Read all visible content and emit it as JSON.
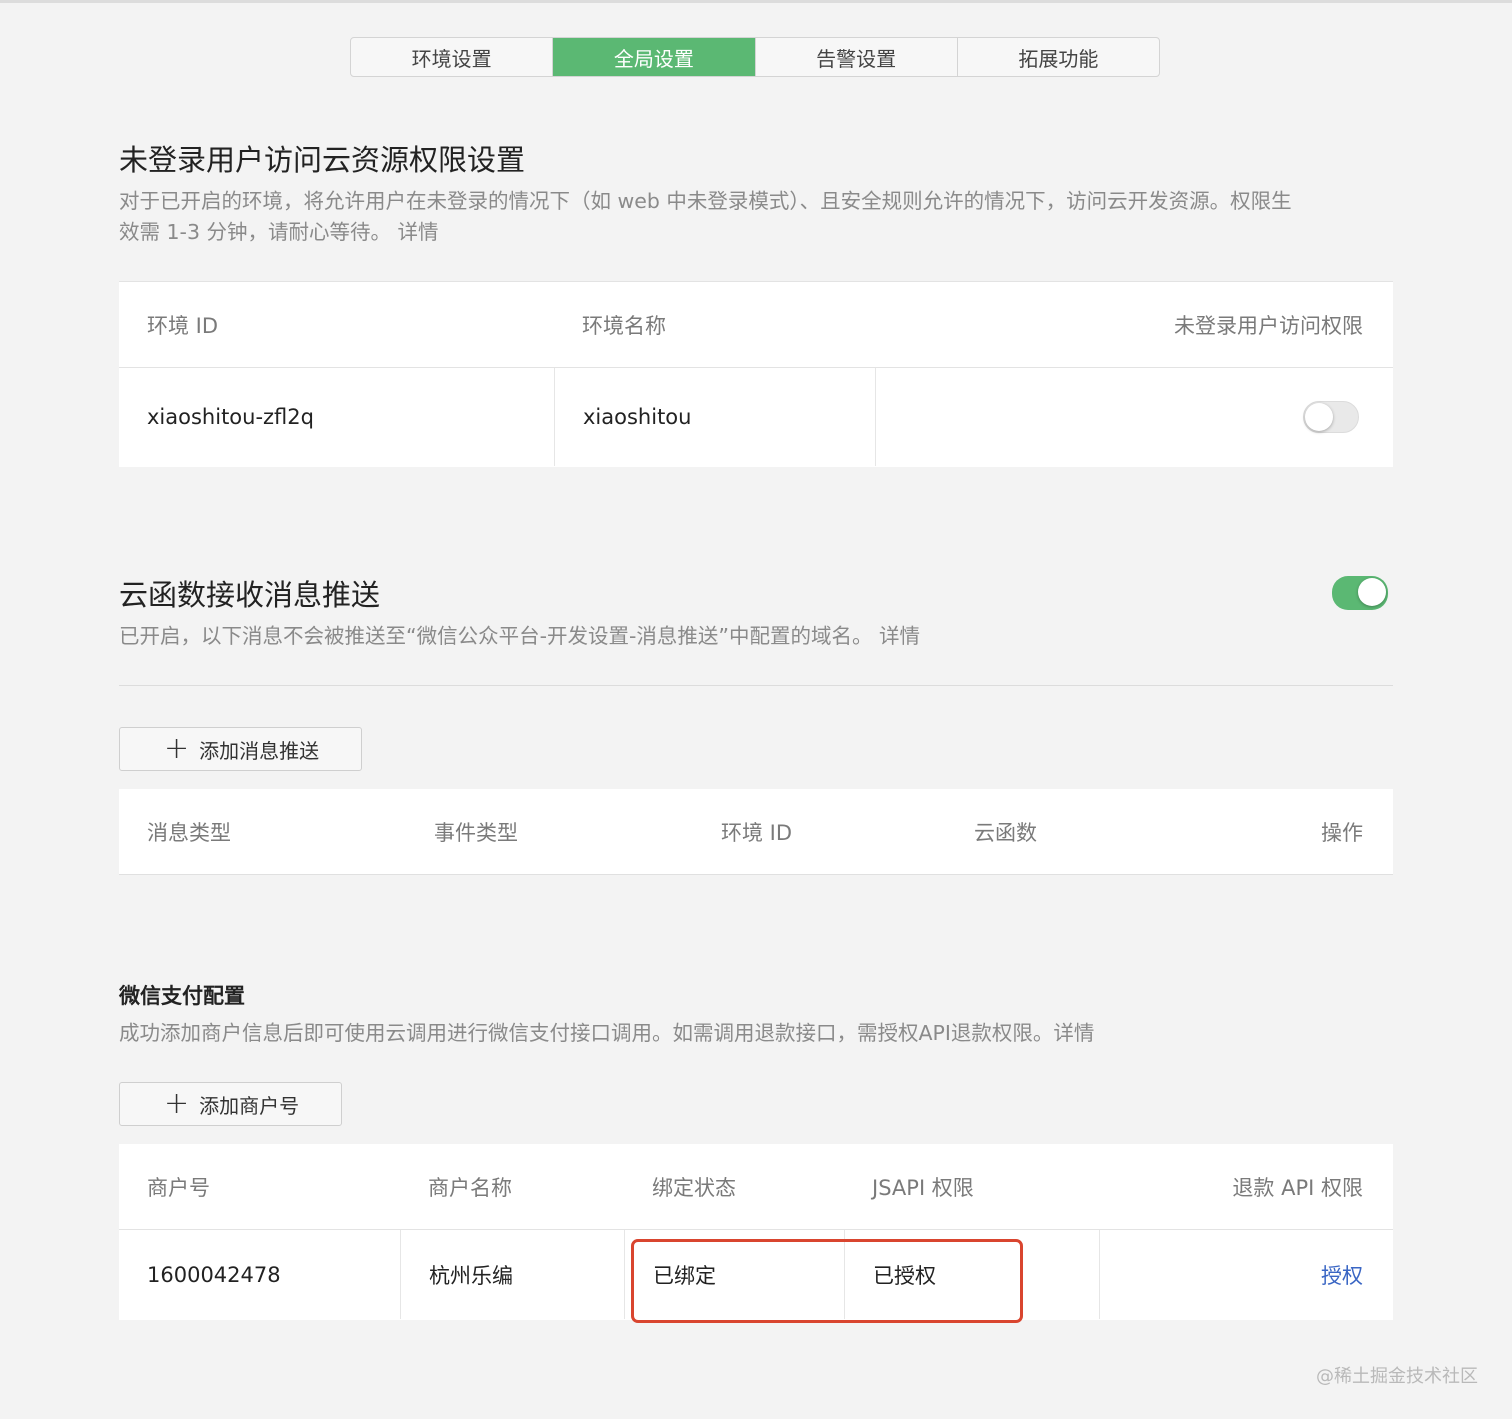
{
  "tabs": [
    {
      "label": "环境设置",
      "active": false
    },
    {
      "label": "全局设置",
      "active": true
    },
    {
      "label": "告警设置",
      "active": false
    },
    {
      "label": "拓展功能",
      "active": false
    }
  ],
  "colors": {
    "accent": "#5bb873",
    "link": "#3a66c4",
    "highlight": "#d9452f"
  },
  "unauth_section": {
    "title": "未登录用户访问云资源权限设置",
    "desc_line1": "对于已开启的环境，将允许用户在未登录的情况下（如 web 中未登录模式）、且安全规则允许的情况下，访问云开发资源。权限生",
    "desc_line2": "效需 1-3 分钟，请耐心等待。 详情",
    "table": {
      "headers": [
        "环境 ID",
        "环境名称",
        "未登录用户访问权限"
      ],
      "rows": [
        {
          "env_id": "xiaoshitou-zfl2q",
          "env_name": "xiaoshitou",
          "access_enabled": false
        }
      ]
    }
  },
  "push_section": {
    "title": "云函数接收消息推送",
    "enabled": true,
    "desc": "已开启，以下消息不会被推送至“微信公众平台-开发设置-消息推送”中配置的域名。 详情",
    "add_button": "添加消息推送",
    "table": {
      "headers": [
        "消息类型",
        "事件类型",
        "环境 ID",
        "云函数",
        "操作"
      ]
    }
  },
  "pay_section": {
    "title": "微信支付配置",
    "desc": "成功添加商户信息后即可使用云调用进行微信支付接口调用。如需调用退款接口，需授权API退款权限。详情",
    "add_button": "添加商户号",
    "table": {
      "headers": [
        "商户号",
        "商户名称",
        "绑定状态",
        "JSAPI 权限",
        "退款 API 权限"
      ],
      "rows": [
        {
          "merchant_id": "1600042478",
          "merchant_name": "杭州乐编",
          "bind_status": "已绑定",
          "jsapi": "已授权",
          "refund_action": "授权"
        }
      ]
    }
  },
  "watermark": "@稀土掘金技术社区"
}
